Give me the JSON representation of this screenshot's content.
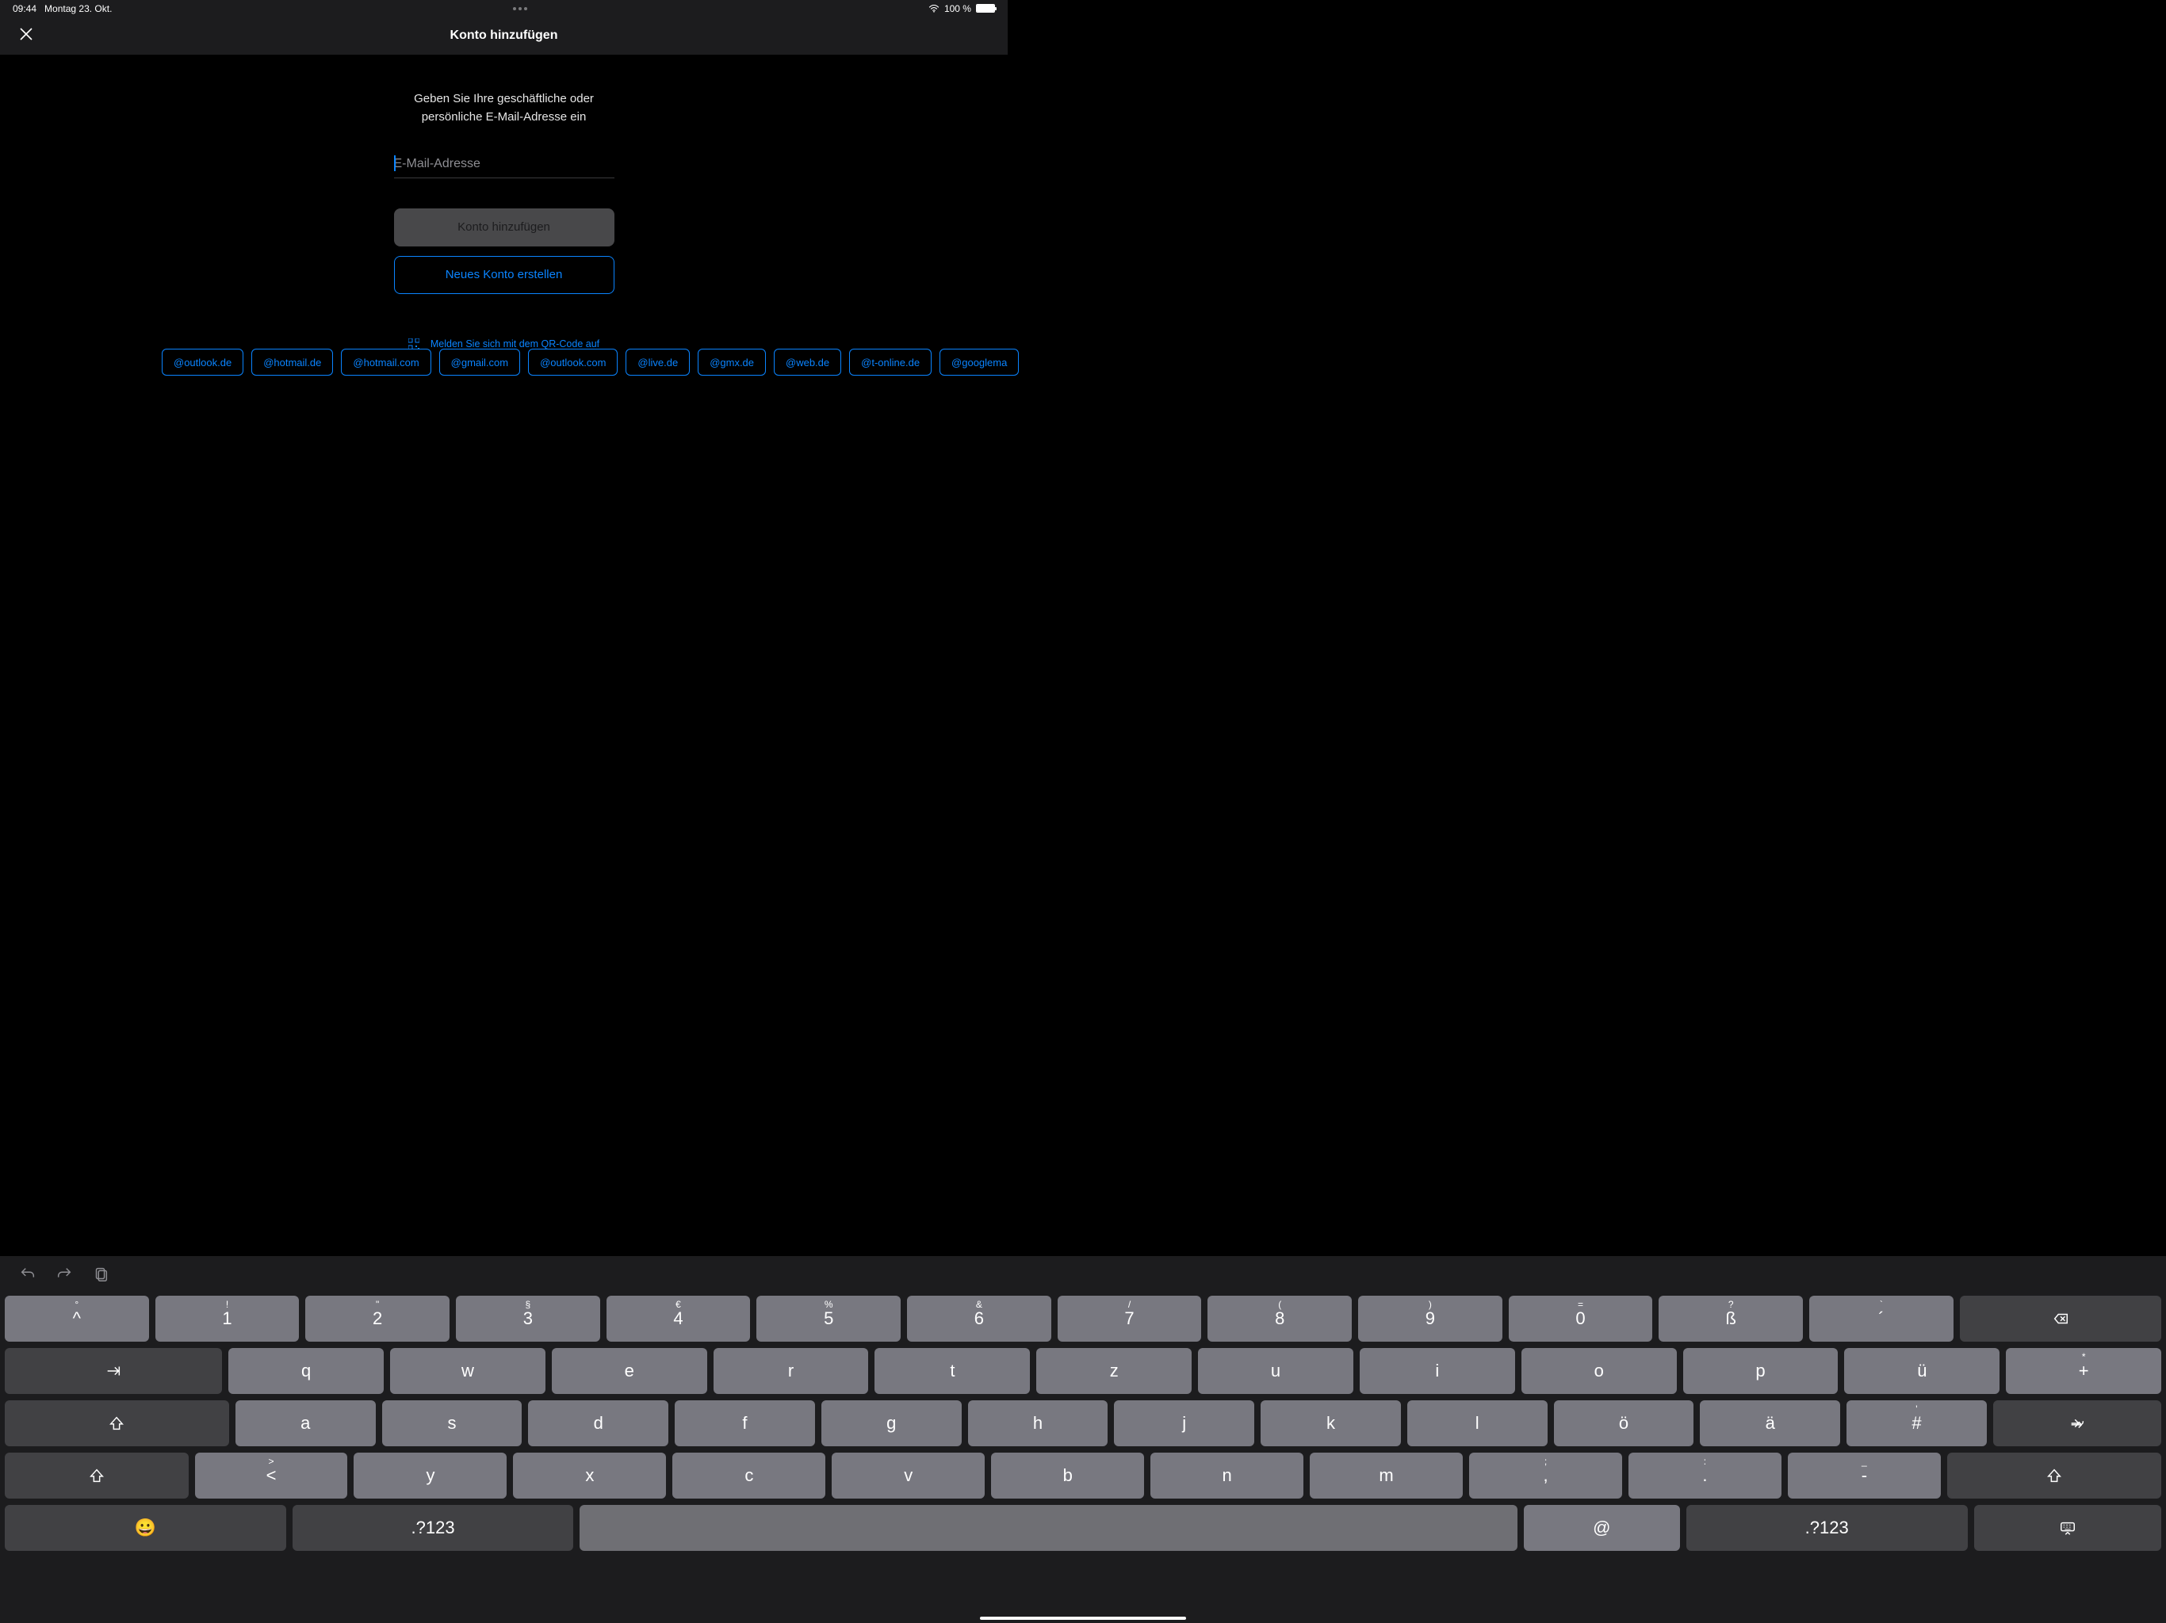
{
  "status": {
    "time": "09:44",
    "date": "Montag 23. Okt.",
    "battery": "100 %"
  },
  "nav": {
    "title": "Konto hinzufügen"
  },
  "content": {
    "prompt_line1": "Geben Sie Ihre geschäftliche oder",
    "prompt_line2": "persönliche E-Mail-Adresse ein",
    "email_placeholder": "E-Mail-Adresse",
    "add_btn": "Konto hinzufügen",
    "create_btn": "Neues Konto erstellen",
    "qr_text": "Melden Sie sich mit dem QR-Code auf"
  },
  "chips": [
    "@outlook.de",
    "@hotmail.de",
    "@hotmail.com",
    "@gmail.com",
    "@outlook.com",
    "@live.de",
    "@gmx.de",
    "@web.de",
    "@t-online.de",
    "@googlema"
  ],
  "keyboard": {
    "row_num": [
      {
        "sup": "°",
        "main": "^",
        "sub": ""
      },
      {
        "sup": "!",
        "main": "1"
      },
      {
        "sup": "\"",
        "main": "2"
      },
      {
        "sup": "§",
        "main": "3"
      },
      {
        "sup": "€",
        "main": "4"
      },
      {
        "sup": "%",
        "main": "5"
      },
      {
        "sup": "&",
        "main": "6"
      },
      {
        "sup": "/",
        "main": "7"
      },
      {
        "sup": "(",
        "main": "8"
      },
      {
        "sup": ")",
        "main": "9"
      },
      {
        "sup": "=",
        "main": "0"
      },
      {
        "sup": "?",
        "main": "ß"
      },
      {
        "sup": "`",
        "main": "´",
        "sub": ""
      }
    ],
    "row_q": [
      "q",
      "w",
      "e",
      "r",
      "t",
      "z",
      "u",
      "i",
      "o",
      "p",
      "ü"
    ],
    "row_q_last": {
      "sup": "*",
      "main": "+"
    },
    "row_a": [
      "a",
      "s",
      "d",
      "f",
      "g",
      "h",
      "j",
      "k",
      "l",
      "ö",
      "ä"
    ],
    "row_a_last": {
      "sup": "'",
      "main": "#"
    },
    "row_z": [
      "y",
      "x",
      "c",
      "v",
      "b",
      "n",
      "m"
    ],
    "row_z_punct": [
      {
        "sup": ";",
        "main": ","
      },
      {
        "sup": ":",
        "main": "."
      },
      {
        "sup": "_",
        "main": "-"
      }
    ],
    "row_z_angle": {
      "sup": ">",
      "main": "<"
    },
    "numkey": ".?123",
    "at": "@"
  }
}
